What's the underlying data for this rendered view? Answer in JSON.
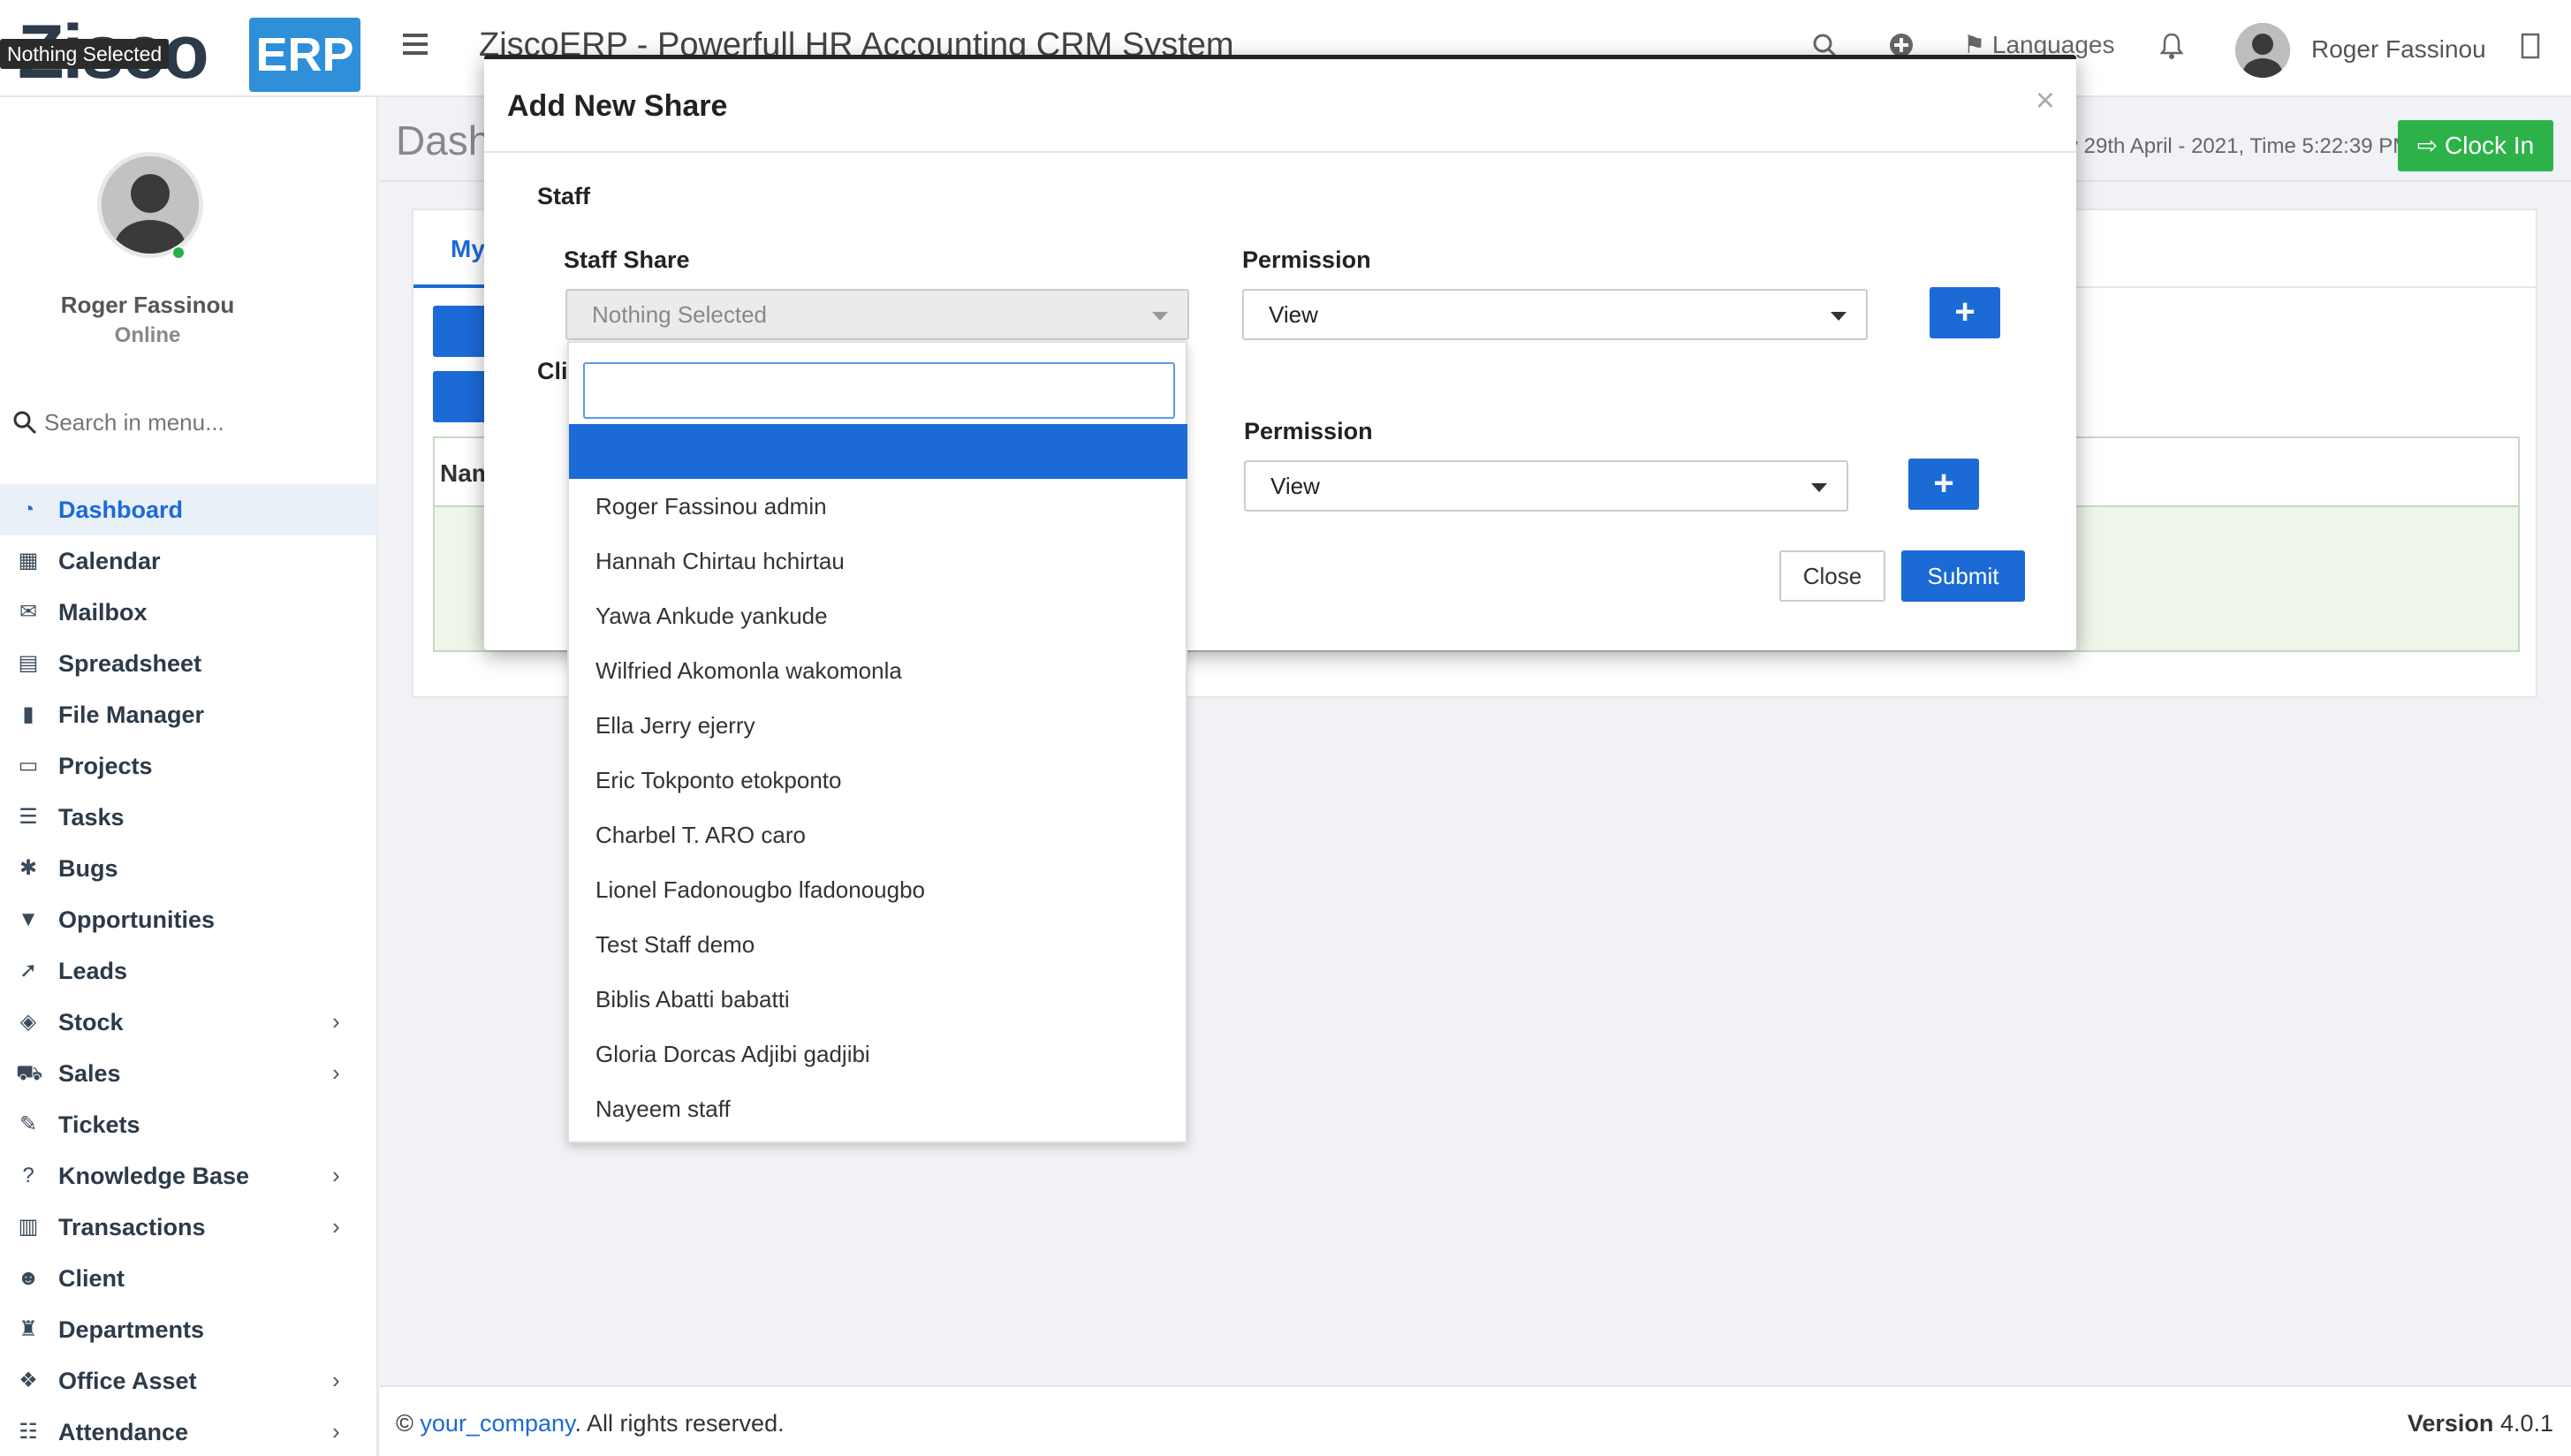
{
  "header": {
    "logo_text": "Zisco",
    "logo_badge": "ERP",
    "title": "ZiscoERP - Powerfull HR Accounting CRM System",
    "languages": "Languages",
    "user_name": "Roger Fassinou",
    "tooltip": "Nothing Selected"
  },
  "sidebar": {
    "user_name": "Roger Fassinou",
    "status": "Online",
    "search_placeholder": "Search in menu...",
    "items": [
      {
        "label": "Dashboard",
        "icon": "dashboard-icon",
        "active": true
      },
      {
        "label": "Calendar",
        "icon": "calendar-icon"
      },
      {
        "label": "Mailbox",
        "icon": "envelope-icon"
      },
      {
        "label": "Spreadsheet",
        "icon": "spreadsheet-icon"
      },
      {
        "label": "File Manager",
        "icon": "file-icon"
      },
      {
        "label": "Projects",
        "icon": "folder-icon"
      },
      {
        "label": "Tasks",
        "icon": "tasks-icon"
      },
      {
        "label": "Bugs",
        "icon": "bug-icon"
      },
      {
        "label": "Opportunities",
        "icon": "filter-icon"
      },
      {
        "label": "Leads",
        "icon": "rocket-icon"
      },
      {
        "label": "Stock",
        "icon": "layers-icon",
        "submenu": true
      },
      {
        "label": "Sales",
        "icon": "cart-icon",
        "submenu": true
      },
      {
        "label": "Tickets",
        "icon": "ticket-icon"
      },
      {
        "label": "Knowledge Base",
        "icon": "question-icon",
        "submenu": true
      },
      {
        "label": "Transactions",
        "icon": "building-icon",
        "submenu": true
      },
      {
        "label": "Client",
        "icon": "users-icon"
      },
      {
        "label": "Departments",
        "icon": "department-icon"
      },
      {
        "label": "Office Asset",
        "icon": "asset-icon",
        "submenu": true
      },
      {
        "label": "Attendance",
        "icon": "attendance-icon",
        "submenu": true
      }
    ]
  },
  "content": {
    "page_title": "Dash",
    "date_line": "y 29th April - 2021,  Time   5:22:39 PM",
    "clock_in": "Clock In",
    "tab_my": "My",
    "table_head_name": "Nam"
  },
  "modal": {
    "title": "Add New Share",
    "close_x": "×",
    "section_staff": "Staff",
    "staff_share_label": "Staff Share",
    "staff_share_value": "Nothing Selected",
    "permission_label": "Permission",
    "permission_value": "View",
    "client_label_partial": "Cli",
    "client_permission_label": "Permission",
    "client_permission_value": "View",
    "plus": "+",
    "close_button": "Close",
    "submit_button": "Submit"
  },
  "dropdown": {
    "search_value": "",
    "options": [
      "Roger Fassinou admin",
      "Hannah Chirtau hchirtau",
      "Yawa Ankude yankude",
      "Wilfried Akomonla wakomonla",
      "Ella Jerry ejerry",
      "Eric Tokponto etokponto",
      "Charbel T. ARO caro",
      "Lionel Fadonougbo lfadonougbo",
      "Test Staff demo",
      "Biblis Abatti babatti",
      "Gloria Dorcas Adjibi gadjibi",
      "Nayeem staff"
    ]
  },
  "footer": {
    "copy_prefix": "© ",
    "company_link": "your_company",
    "copy_suffix": ". All rights reserved.",
    "version_label": "Version",
    "version_number": "4.0.1"
  },
  "colors": {
    "accent": "#1b6ad6",
    "success": "#2db24a",
    "logo_badge": "#2f8fd8"
  }
}
